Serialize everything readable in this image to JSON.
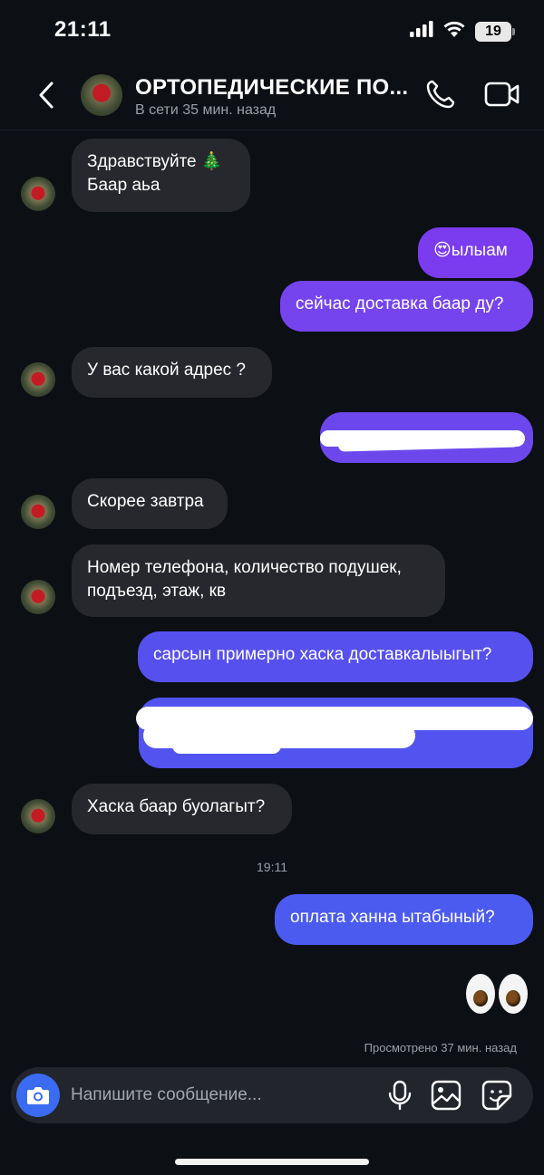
{
  "status_bar": {
    "time": "21:11",
    "battery": "19"
  },
  "header": {
    "title": "ОРТОПЕДИЧЕСКИЕ ПО...",
    "subtitle": "В сети 35 мин. назад"
  },
  "messages": [
    {
      "text": "Здравствуйте 🎄",
      "text2": "Баар аьа"
    },
    {
      "text": "😍ылыам"
    },
    {
      "text": "сейчас доставка баар ду?"
    },
    {
      "text": "У вас какой адрес ?"
    },
    {
      "text": ""
    },
    {
      "text": "Скорее завтра"
    },
    {
      "text": "Номер телефона, количество подушек,",
      "text2": "подъезд, этаж, кв"
    },
    {
      "text": "сарсын примерно хаска доставкалыыгыт?"
    },
    {
      "text": ""
    },
    {
      "text": "Хаска баар буолагыт?"
    },
    {
      "text": "оплата ханна ытабыный?"
    }
  ],
  "timestamp": "19:11",
  "seen_status": "Просмотрено 37 мин. назад",
  "composer": {
    "placeholder": "Напишите сообщение..."
  },
  "colors": {
    "background": "#0c0f14",
    "incoming_bubble": "#26282d",
    "outgoing_purple": "#7b3cf0",
    "outgoing_blue": "#4b5bf0",
    "camera_button": "#3a6bf0"
  }
}
